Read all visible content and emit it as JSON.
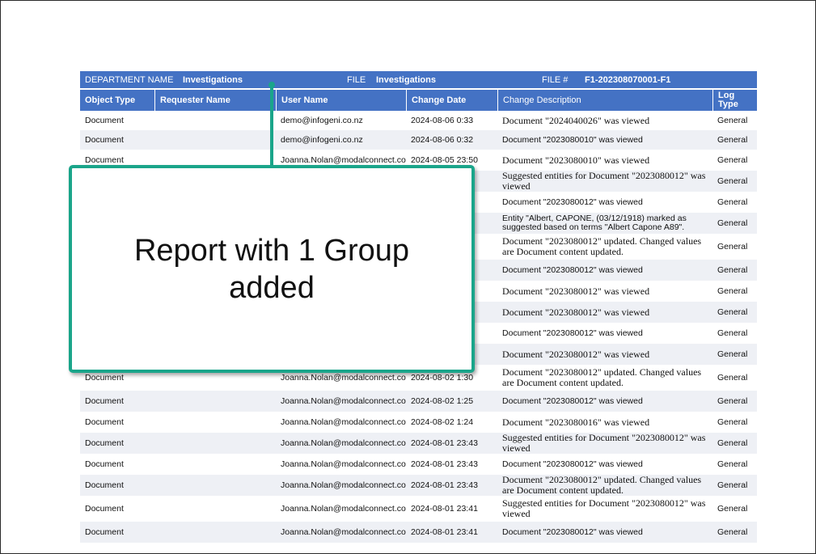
{
  "group_header": {
    "department_label": "DEPARTMENT NAME",
    "department_value": "Investigations",
    "file_label": "FILE",
    "file_value": "Investigations",
    "file_no_label": "FILE #",
    "file_no_value": "F1-202308070001-F1"
  },
  "columns": [
    "Object Type",
    "Requester Name",
    "User Name",
    "Change Date",
    "Change Description",
    "Log Type"
  ],
  "rows": [
    {
      "object": "Document",
      "requester": "",
      "user": "demo@infogeni.co.nz",
      "date": "2024-08-06 0:33",
      "desc": "Document \"2024040026\" was viewed",
      "log": "General"
    },
    {
      "object": "Document",
      "requester": "",
      "user": "demo@infogeni.co.nz",
      "date": "2024-08-06 0:32",
      "desc": "Document \"2023080010\" was viewed",
      "log": "General"
    },
    {
      "object": "Document",
      "requester": "",
      "user": "Joanna.Nolan@modalconnect.com",
      "date": "2024-08-05 23:50",
      "desc": "Document \"2023080010\" was viewed",
      "log": "General"
    },
    {
      "object": "",
      "requester": "",
      "user": "",
      "date": "",
      "desc": "Suggested entities for Document \"2023080012\" was viewed",
      "log": "General"
    },
    {
      "object": "",
      "requester": "",
      "user": "",
      "date": "",
      "desc": "Document \"2023080012\" was viewed",
      "log": "General"
    },
    {
      "object": "",
      "requester": "",
      "user": "",
      "date": "",
      "desc": "Entity \"Albert, CAPONE, (03/12/1918) marked as suggested based on terms \"Albert Capone A89\".",
      "log": "General"
    },
    {
      "object": "",
      "requester": "",
      "user": "",
      "date": "",
      "desc": "Document \"2023080012\" updated. Changed values are Document content updated.",
      "log": "General"
    },
    {
      "object": "",
      "requester": "",
      "user": "",
      "date": "",
      "desc": "Document \"2023080012\" was viewed",
      "log": "General"
    },
    {
      "object": "",
      "requester": "",
      "user": "",
      "date": "",
      "desc": "Document \"2023080012\" was viewed",
      "log": "General"
    },
    {
      "object": "",
      "requester": "",
      "user": "",
      "date": "",
      "desc": "Document \"2023080012\" was viewed",
      "log": "General"
    },
    {
      "object": "",
      "requester": "",
      "user": "",
      "date": "",
      "desc": "Document \"2023080012\" was viewed",
      "log": "General"
    },
    {
      "object": "",
      "requester": "",
      "user": "",
      "date": "",
      "desc": "Document \"2023080012\" was viewed",
      "log": "General"
    },
    {
      "object": "Document",
      "requester": "",
      "user": "Joanna.Nolan@modalconnect.com",
      "date": "2024-08-02 1:30",
      "desc": "Document \"2023080012\" updated. Changed values are Document content updated.",
      "log": "General"
    },
    {
      "object": "Document",
      "requester": "",
      "user": "Joanna.Nolan@modalconnect.com",
      "date": "2024-08-02 1:25",
      "desc": "Document \"2023080012\" was viewed",
      "log": "General"
    },
    {
      "object": "Document",
      "requester": "",
      "user": "Joanna.Nolan@modalconnect.com",
      "date": "2024-08-02 1:24",
      "desc": "Document \"2023080016\" was viewed",
      "log": "General"
    },
    {
      "object": "Document",
      "requester": "",
      "user": "Joanna.Nolan@modalconnect.com",
      "date": "2024-08-01 23:43",
      "desc": "Suggested entities for Document \"2023080012\" was viewed",
      "log": "General"
    },
    {
      "object": "Document",
      "requester": "",
      "user": "Joanna.Nolan@modalconnect.com",
      "date": "2024-08-01 23:43",
      "desc": "Document \"2023080012\" was viewed",
      "log": "General"
    },
    {
      "object": "Document",
      "requester": "",
      "user": "Joanna.Nolan@modalconnect.com",
      "date": "2024-08-01 23:43",
      "desc": "Document \"2023080012\" updated. Changed values are Document content updated.",
      "log": "General"
    },
    {
      "object": "Document",
      "requester": "",
      "user": "Joanna.Nolan@modalconnect.com",
      "date": "2024-08-01 23:41",
      "desc": "Suggested entities for Document \"2023080012\" was viewed",
      "log": "General"
    },
    {
      "object": "Document",
      "requester": "",
      "user": "Joanna.Nolan@modalconnect.com",
      "date": "2024-08-01 23:41",
      "desc": "Document \"2023080012\" was viewed",
      "log": "General"
    }
  ],
  "callout": {
    "text": "Report with 1 Group added"
  }
}
